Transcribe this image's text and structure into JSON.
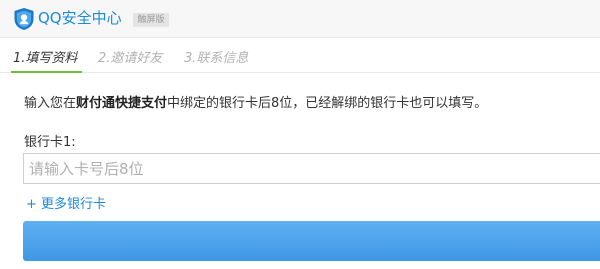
{
  "header": {
    "brand": "QQ安全中心",
    "badge": "触屏版"
  },
  "steps": [
    {
      "label": "1.填写资料",
      "active": true
    },
    {
      "label": "2.邀请好友",
      "active": false
    },
    {
      "label": "3.联系信息",
      "active": false
    }
  ],
  "form": {
    "instruction_prefix": "输入您在",
    "instruction_bold": "财付通快捷支付",
    "instruction_suffix": "中绑定的银行卡后8位，已经解绑的银行卡也可以填写。",
    "card_label": "银行卡1:",
    "card_placeholder": "请输入卡号后8位",
    "card_value": "",
    "more_cards": "+ 更多银行卡",
    "submit_label": ""
  },
  "colors": {
    "brand": "#1d8ad8",
    "active_step_underline": "#6fbf3a",
    "submit": "#4aa3ec"
  }
}
